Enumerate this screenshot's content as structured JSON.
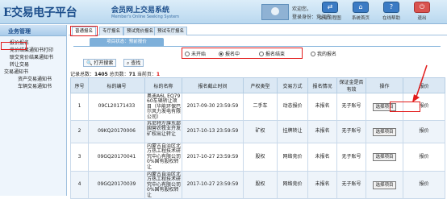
{
  "header": {
    "logo": "E交易电子平台",
    "system_name": "会员网上交易系统",
    "system_name_en": "Member's Online Seeking System",
    "welcome": "欢迎您，",
    "identity_label": "登录身份：",
    "identity_value": "竞买方",
    "buttons": [
      {
        "label": "交易流程图",
        "icon": "flowchart-icon"
      },
      {
        "label": "系统首页",
        "icon": "home-icon"
      },
      {
        "label": "在线帮助",
        "icon": "help-icon"
      },
      {
        "label": "退出",
        "icon": "exit-icon"
      }
    ]
  },
  "sidebar": {
    "title": "业务管理",
    "items": [
      {
        "label": "报价报名",
        "level": 1,
        "highlighted": true
      },
      {
        "label": "竞价结果通知书打印",
        "level": 1
      },
      {
        "label": "联交竞价结果通知书",
        "level": 1
      },
      {
        "label": "转让交易",
        "level": 1
      },
      {
        "label": "交易通知书",
        "level": 0
      },
      {
        "label": "资产交易通知书",
        "level": 2
      },
      {
        "label": "车辆交易通知书",
        "level": 2
      }
    ]
  },
  "tabs": [
    {
      "label": "普通报名",
      "active": true
    },
    {
      "label": "专厅报名",
      "active": false
    },
    {
      "label": "预试竞价报名",
      "active": false
    },
    {
      "label": "预试专厅报名",
      "active": false
    }
  ],
  "section_title": "项目状态：预前报价",
  "radios": [
    {
      "label": "未开始",
      "checked": false
    },
    {
      "label": "报名中",
      "checked": true
    },
    {
      "label": "报名结束",
      "checked": false
    },
    {
      "label": "我的报名",
      "checked": false
    }
  ],
  "toolbar": {
    "open_search_label": "打开搜索",
    "search_label": "查找"
  },
  "records": {
    "prefix": "记录总数：",
    "total": "1405",
    "middle": " 总页数：",
    "pages": "71",
    "page_label": " 当前页：",
    "current": "1"
  },
  "table": {
    "headers": [
      "序号",
      "标的编号",
      "标的名称",
      "报名截止时间",
      "产权类型",
      "交易方式",
      "报名情况",
      "保证金是否有效",
      "操作",
      "报价"
    ],
    "rows": [
      {
        "no": "1",
        "code": "09CL20171433",
        "name": "奥迪A6L EQ7960车辆转让项目（华能环保巴尔风力发电有限公司）",
        "deadline": "2017-09-30 23:59:59",
        "ptype": "二手车",
        "method": "动态报价",
        "status": "未报名",
        "deposit": "无子账号",
        "action": "选择项目",
        "quote": "报价"
      },
      {
        "no": "2",
        "code": "09KQ20170006",
        "name": "苏尼特左旗东部国营农牧业开发矿权出让转让",
        "deadline": "2017-10-13 23:59:59",
        "ptype": "矿权",
        "method": "挂牌转让",
        "status": "未报名",
        "deposit": "无子账号",
        "action": "选择项目",
        "quote": "报价"
      },
      {
        "no": "3",
        "code": "09GQ20170041",
        "name": "内蒙古自治区北方热工程技术研究中心有限公司0%国有股权转让",
        "deadline": "2017-10-27 23:59:59",
        "ptype": "股权",
        "method": "网络竞价",
        "status": "未报名",
        "deposit": "无子账号",
        "action": "选择项目",
        "quote": "报价"
      },
      {
        "no": "4",
        "code": "09GQ20170039",
        "name": "内蒙古自治区北方热工程技术研究中心有限公司0%国有股权转让",
        "deadline": "2017-10-27 23:59:59",
        "ptype": "股权",
        "method": "网络竞价",
        "status": "未报名",
        "deposit": "无子账号",
        "action": "选择项目",
        "quote": "报价"
      }
    ]
  },
  "colors": {
    "header_bg": "#c7e0f4",
    "accent": "#1d4f8c",
    "highlight": "#e21b1b"
  }
}
